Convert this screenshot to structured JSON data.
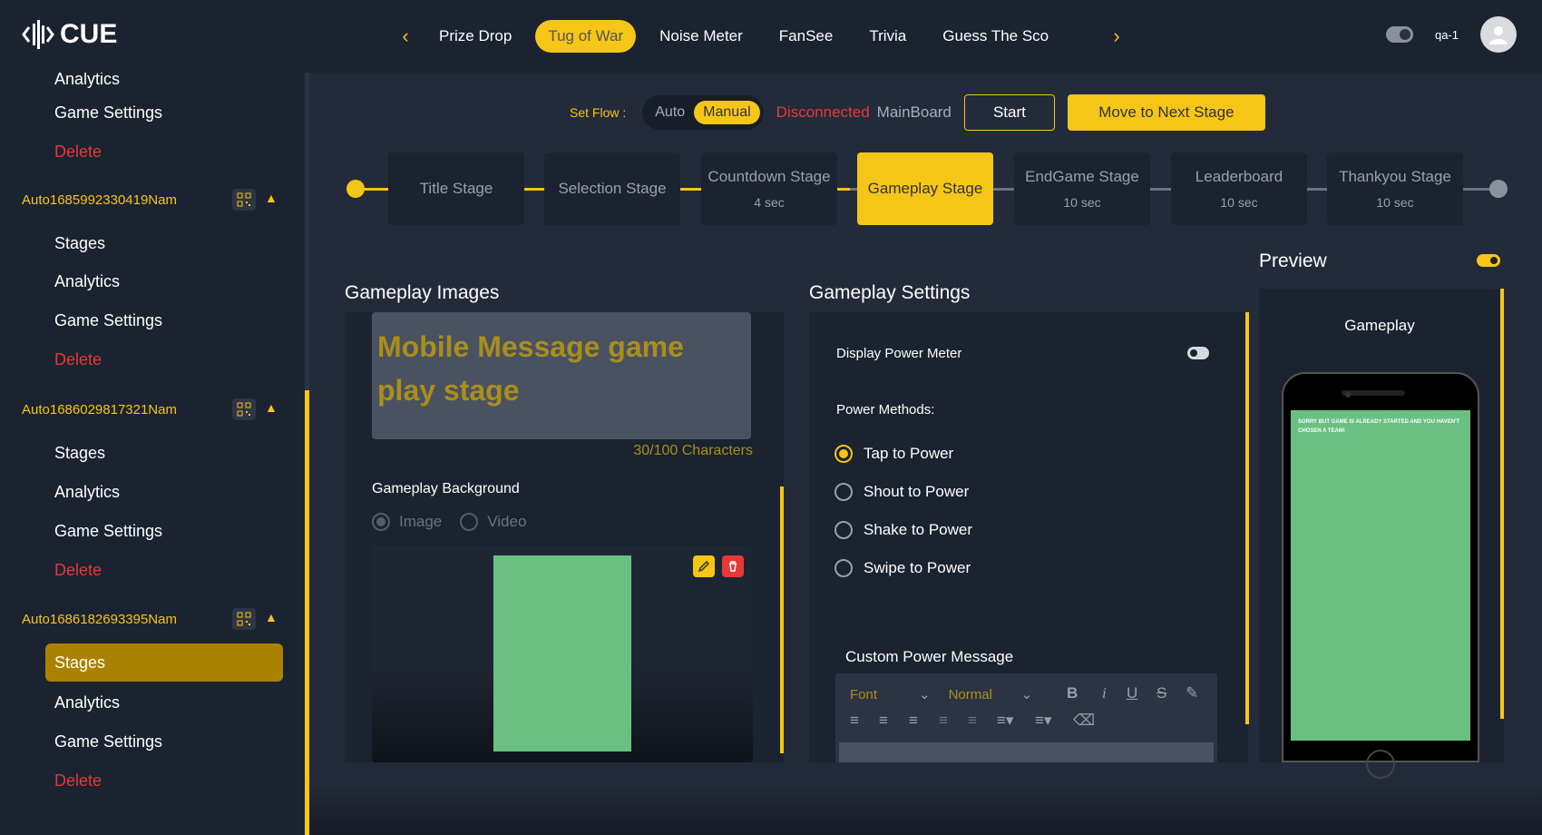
{
  "app": {
    "brand": "CUE",
    "user": "qa-1"
  },
  "colors": {
    "accent": "#f5c518",
    "danger": "#e53935",
    "success_green": "#6abf83",
    "panel": "#1b2230",
    "background": "#232b3a"
  },
  "header": {
    "game_tabs": [
      "Prize Drop",
      "Tug of War",
      "Noise Meter",
      "FanSee",
      "Trivia",
      "Guess The Sco"
    ],
    "active_tab": "Tug of War"
  },
  "sidebar": {
    "top_items": [
      {
        "label": "Analytics",
        "type": "link"
      },
      {
        "label": "Game Settings",
        "type": "link"
      },
      {
        "label": "Delete",
        "type": "delete"
      }
    ],
    "groups": [
      {
        "name": "Auto1685992330419Nam",
        "items": [
          "Stages",
          "Analytics",
          "Game Settings",
          "Delete"
        ]
      },
      {
        "name": "Auto1686029817321Nam",
        "items": [
          "Stages",
          "Analytics",
          "Game Settings",
          "Delete"
        ]
      },
      {
        "name": "Auto1686182693395Nam",
        "items": [
          "Stages",
          "Analytics",
          "Game Settings",
          "Delete"
        ],
        "active_item": "Stages"
      }
    ]
  },
  "flow": {
    "label": "Set Flow :",
    "auto": "Auto",
    "manual": "Manual",
    "selected": "Manual",
    "status": "Disconnected",
    "board": "MainBoard",
    "start": "Start",
    "next": "Move to Next Stage"
  },
  "stages": [
    {
      "name": "Title Stage",
      "time": ""
    },
    {
      "name": "Selection Stage",
      "time": ""
    },
    {
      "name": "Countdown Stage",
      "time": "4 sec"
    },
    {
      "name": "Gameplay Stage",
      "time": "",
      "active": true
    },
    {
      "name": "EndGame Stage",
      "time": "10 sec"
    },
    {
      "name": "Leaderboard",
      "time": "10 sec"
    },
    {
      "name": "Thankyou Stage",
      "time": "10 sec"
    }
  ],
  "gameplay_images": {
    "title": "Gameplay Images",
    "message": "Mobile Message game play stage",
    "char_count": "30/100 Characters",
    "background_label": "Gameplay Background",
    "options": [
      "Image",
      "Video"
    ],
    "selected_option": "Image"
  },
  "gameplay_settings": {
    "title": "Gameplay Settings",
    "power_meter_label": "Display Power Meter",
    "power_meter_on": false,
    "methods_label": "Power Methods:",
    "methods": [
      "Tap to Power",
      "Shout to Power",
      "Shake to Power",
      "Swipe to Power"
    ],
    "selected_method": "Tap to Power",
    "custom_message_label": "Custom Power Message",
    "editor": {
      "font": "Font",
      "size": "Normal"
    }
  },
  "preview": {
    "title": "Preview",
    "enabled": true,
    "screen_title": "Gameplay",
    "phone_message": "Sorry but game is already started and you haven't chosen a team!"
  }
}
